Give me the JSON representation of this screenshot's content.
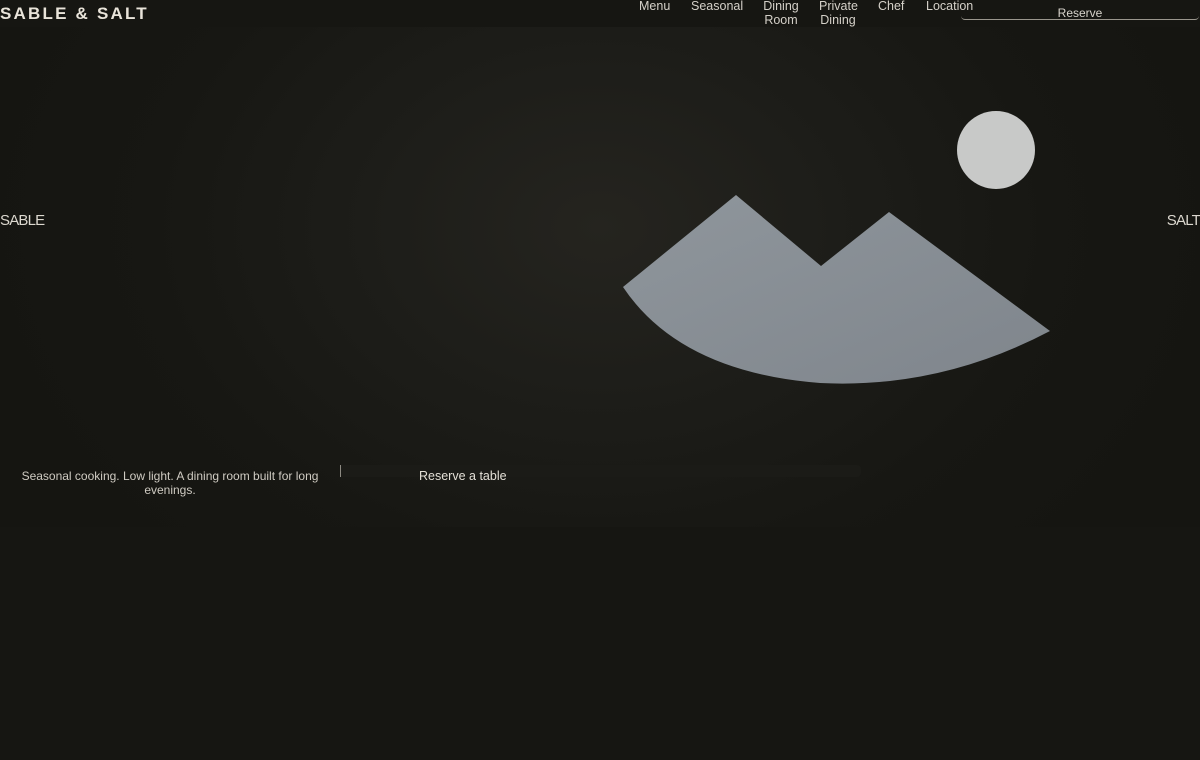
{
  "header": {
    "brand": "SABLE & SALT",
    "nav": {
      "menu": "Menu",
      "seasonal": "Seasonal",
      "dining_room": "Dining Room",
      "private_dining": "Private Dining",
      "chef": "Chef",
      "location": "Location"
    },
    "reserve_label": "Reserve"
  },
  "hero": {
    "left_word": "SABLE",
    "right_word": "SALT",
    "tagline": "Seasonal cooking. Low light. A dining room built for long evenings.",
    "cta_label": "Reserve a table"
  },
  "colors": {
    "background": "#161612",
    "moon": "#c8c9c8",
    "mountain": "#8f969c",
    "text": "#e7e3da"
  },
  "icons": {
    "hero_image": "image-placeholder-icon"
  }
}
